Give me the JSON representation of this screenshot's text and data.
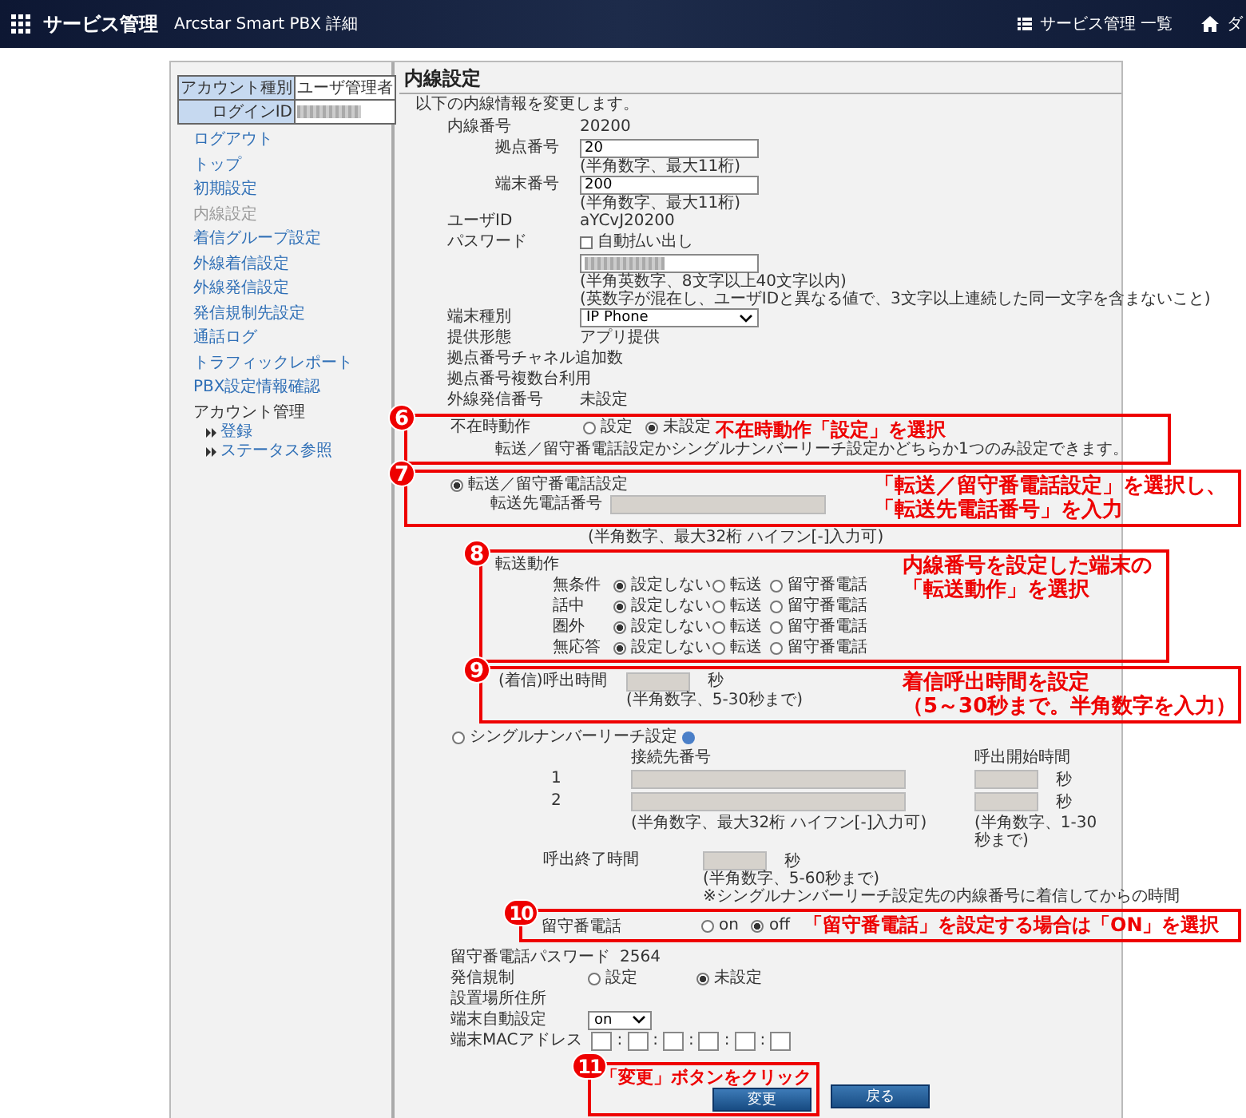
{
  "top_bar": {
    "app_title": "サービス管理",
    "subtitle": "Arcstar Smart PBX 詳細",
    "links": [
      {
        "label": "サービス管理 一覧",
        "kind": "list"
      },
      {
        "label": "ダ",
        "kind": "home"
      }
    ]
  },
  "sidebar": {
    "account_type": {
      "label": "アカウント種別",
      "value": "ユーザ管理者"
    },
    "login_id": {
      "label": "ログインID"
    },
    "items": [
      {
        "label": "ログアウト",
        "selected": false
      },
      {
        "label": "トップ",
        "selected": false
      },
      {
        "label": "初期設定",
        "selected": false
      },
      {
        "label": "内線設定",
        "selected": true
      },
      {
        "label": "着信グループ設定",
        "selected": false
      },
      {
        "label": "外線着信設定",
        "selected": false
      },
      {
        "label": "外線発信設定",
        "selected": false
      },
      {
        "label": "発信規制先設定",
        "selected": false
      },
      {
        "label": "通話ログ",
        "selected": false
      },
      {
        "label": "トラフィックレポート",
        "selected": false
      },
      {
        "label": "PBX設定情報確認",
        "selected": false
      }
    ],
    "account_menu": {
      "label": "アカウント管理",
      "items": [
        "登録",
        "ステータス参照"
      ]
    }
  },
  "main": {
    "title": "内線設定",
    "intro": "以下の内線情報を変更します。",
    "extension": {
      "label": "内線番号",
      "value": "20200"
    },
    "base_number": {
      "label": "拠点番号",
      "value": "20",
      "hint": "(半角数字、最大11桁)"
    },
    "terminal_number": {
      "label": "端末番号",
      "value": "200",
      "hint": "(半角数字、最大11桁)"
    },
    "user_id": {
      "label": "ユーザID",
      "value": "aYCvJ20200"
    },
    "password": {
      "label": "パスワード",
      "auto_label": "自動払い出し",
      "auto_checked": false,
      "hints": [
        "(半角英数字、8文字以上40文字以内)",
        "(英数字が混在し、ユーザIDと異なる値で、3文字以上連続した同一文字を含まないこと)"
      ]
    },
    "terminal_type": {
      "label": "端末種別",
      "value": "IP Phone"
    },
    "info_rows": [
      {
        "label": "提供形態",
        "value": "アプリ提供"
      },
      {
        "label": "拠点番号チャネル追加数"
      },
      {
        "label": "拠点番号複数台利用"
      },
      {
        "label": "外線発信番号",
        "value": "未設定"
      }
    ],
    "absence": {
      "label": "不在時動作",
      "options": [
        {
          "label": "設定",
          "selected": false
        },
        {
          "label": "未設定",
          "selected": true
        }
      ],
      "note": "転送／留守番電話設定かシングルナンバーリーチ設定かどちらか1つのみ設定できます。"
    },
    "forwarding": {
      "label": "転送／留守番電話設定",
      "selected": true,
      "disabled": true,
      "number_label": "転送先電話番号",
      "number_hint": "(半角数字、最大32桁 ハイフン[-]入力可)",
      "action_label": "転送動作",
      "action_rows": [
        {
          "label": "無条件",
          "options": [
            {
              "label": "設定しない",
              "selected": true
            },
            {
              "label": "転送",
              "selected": false
            },
            {
              "label": "留守番電話",
              "selected": false
            }
          ]
        },
        {
          "label": "話中",
          "options": [
            {
              "label": "設定しない",
              "selected": true
            },
            {
              "label": "転送",
              "selected": false
            },
            {
              "label": "留守番電話",
              "selected": false
            }
          ]
        },
        {
          "label": "圏外",
          "options": [
            {
              "label": "設定しない",
              "selected": true
            },
            {
              "label": "転送",
              "selected": false
            },
            {
              "label": "留守番電話",
              "selected": false
            }
          ]
        },
        {
          "label": "無応答",
          "options": [
            {
              "label": "設定しない",
              "selected": true
            },
            {
              "label": "転送",
              "selected": false
            },
            {
              "label": "留守番電話",
              "selected": false
            }
          ]
        }
      ],
      "ring_label": "(着信)呼出時間",
      "ring_unit": "秒",
      "ring_hint": "(半角数字、5-30秒まで)"
    },
    "single_number": {
      "label": "シングルナンバーリーチ設定",
      "selected": false,
      "disabled": true,
      "number_header": "接続先番号",
      "start_header": "呼出開始時間",
      "rows": [
        {
          "index": "1",
          "unit": "秒"
        },
        {
          "index": "2",
          "unit": "秒"
        }
      ],
      "number_hint": "(半角数字、最大32桁 ハイフン[-]入力可)",
      "start_hint": "(半角数字、1-30秒まで)",
      "end_label": "呼出終了時間",
      "end_unit": "秒",
      "end_hints": [
        "(半角数字、5-60秒まで)",
        "※シングルナンバーリーチ設定先の内線番号に着信してからの時間"
      ],
      "voicemail": {
        "label": "留守番電話",
        "options": [
          {
            "label": "on",
            "selected": false
          },
          {
            "label": "off",
            "selected": true
          }
        ]
      }
    },
    "voicemail_password": {
      "label": "留守番電話パスワード",
      "value": "2564"
    },
    "outgoing_restriction": {
      "label": "発信規制",
      "options": [
        {
          "label": "設定",
          "selected": false
        },
        {
          "label": "未設定",
          "selected": true
        }
      ]
    },
    "install_address": {
      "label": "設置場所住所"
    },
    "auto_config": {
      "label": "端末自動設定",
      "value": "on"
    },
    "mac": {
      "label": "端末MACアドレス",
      "separators": [
        ":",
        ":",
        ":",
        ":",
        ":"
      ]
    },
    "buttons": [
      {
        "label": "変更",
        "kind": "primary"
      },
      {
        "label": "戻る",
        "kind": "secondary"
      }
    ]
  },
  "annotations": [
    {
      "number": "6",
      "text": "不在時動作「設定」を選択"
    },
    {
      "number": "7",
      "lines": [
        "「転送／留守番電話設定」を選択し、",
        "「転送先電話番号」を入力"
      ]
    },
    {
      "number": "8",
      "lines": [
        "内線番号を設定した端末の",
        "「転送動作」を選択"
      ]
    },
    {
      "number": "9",
      "lines": [
        "着信呼出時間を設定",
        "（5～30秒まで。半角数字を入力）"
      ]
    },
    {
      "number": "10",
      "text": "「留守番電話」を設定する場合は「ON」を選択"
    },
    {
      "number": "11",
      "text": "「変更」ボタンをクリック"
    }
  ]
}
